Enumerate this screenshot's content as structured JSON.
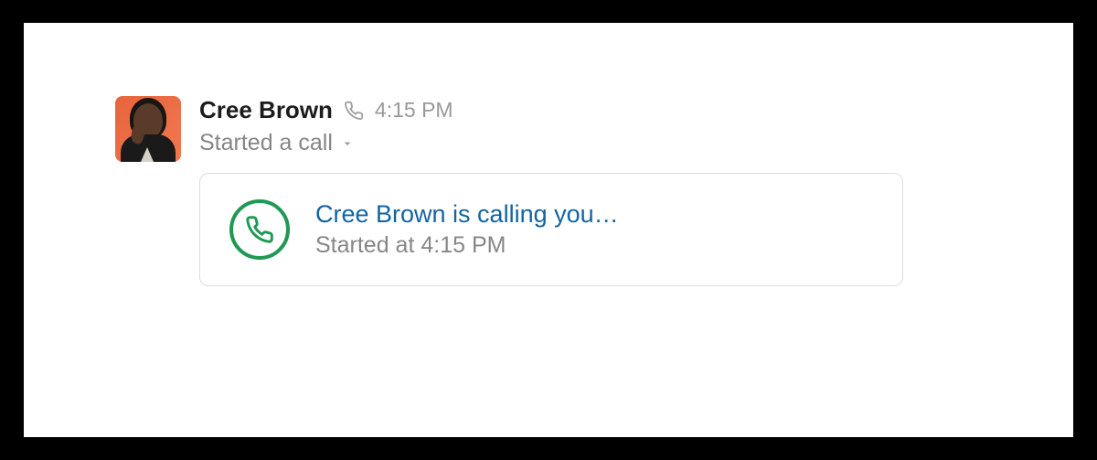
{
  "message": {
    "username": "Cree Brown",
    "timestamp": "4:15 PM",
    "action_text": "Started a call"
  },
  "call_card": {
    "title": "Cree Brown is calling you…",
    "subtitle": "Started at 4:15 PM"
  },
  "colors": {
    "accent_green": "#1f9954",
    "link_blue": "#1264a3",
    "muted_text": "#868686"
  }
}
